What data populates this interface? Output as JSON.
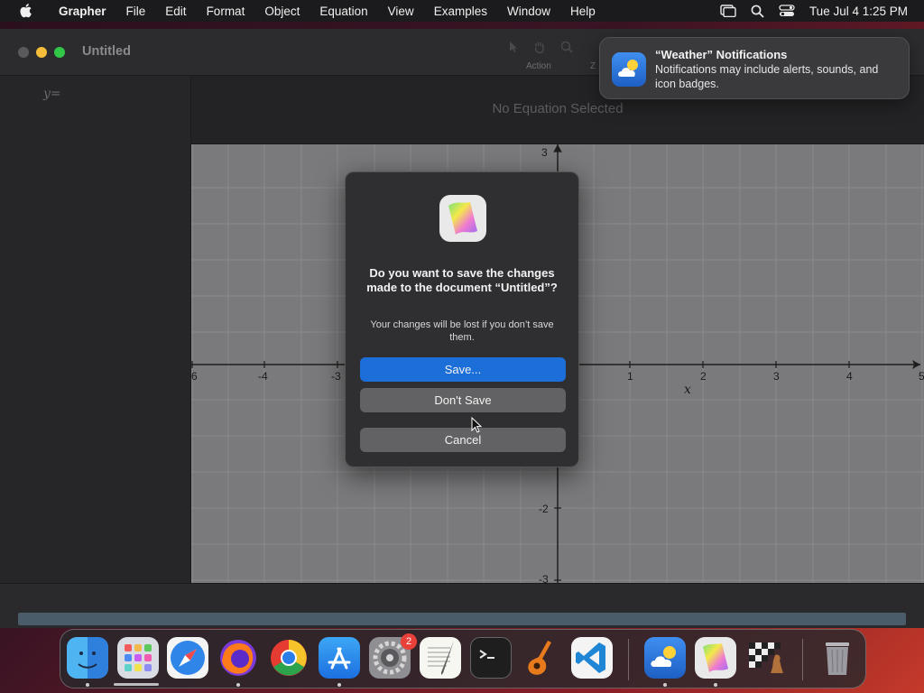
{
  "menubar": {
    "app_name": "Grapher",
    "items": [
      "File",
      "Edit",
      "Format",
      "Object",
      "Equation",
      "View",
      "Examples",
      "Window",
      "Help"
    ],
    "clock": "Tue Jul 4  1:25 PM"
  },
  "window": {
    "title": "Untitled",
    "toolbar_labels": [
      "Action",
      "Z"
    ],
    "sidebar_label": "y=",
    "add_label": "+",
    "no_equation": "No Equation Selected"
  },
  "graph": {
    "x_ticks": [
      "6",
      "-4",
      "-3",
      "1",
      "2",
      "3",
      "4",
      "5"
    ],
    "y_ticks": [
      "3",
      "-2",
      "-3"
    ],
    "x_axis_label": "x",
    "background": "#7a7a7c"
  },
  "dialog": {
    "headline": "Do you want to save the changes made to the document “Untitled”?",
    "subtext": "Your changes will be lost if you don’t save them.",
    "save_label": "Save...",
    "dont_save_label": "Don't Save",
    "cancel_label": "Cancel",
    "accent": "#1c6ed9"
  },
  "notification": {
    "title": "“Weather” Notifications",
    "body": "Notifications may include alerts, sounds, and icon badges."
  },
  "dock": {
    "settings_badge": "2",
    "apps": [
      "finder-icon",
      "launchpad-icon",
      "safari-icon",
      "firefox-icon",
      "chrome-icon",
      "app-store-icon",
      "system-settings-icon",
      "textedit-icon",
      "terminal-icon",
      "garageband-icon",
      "vscode-icon",
      "weather-icon",
      "grapher-icon",
      "chess-icon",
      "trash-icon"
    ]
  }
}
